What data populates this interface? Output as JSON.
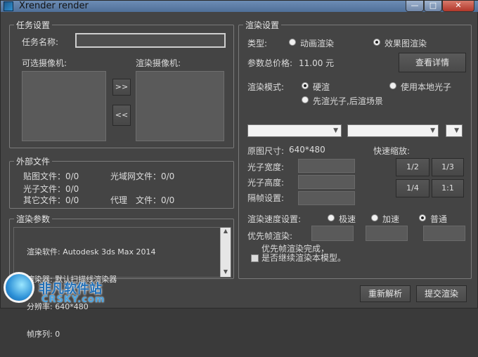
{
  "window": {
    "title": "Xrender render",
    "buttons": {
      "minimize": "—",
      "maximize": "□",
      "close": "✕"
    }
  },
  "task": {
    "group_label": "任务设置",
    "name_label": "任务名称:",
    "name_value": "",
    "available_cameras_label": "可选摄像机:",
    "render_cameras_label": "渲染摄像机:",
    "add_btn": ">>",
    "remove_btn": "<<"
  },
  "external_files": {
    "group_label": "外部文件",
    "map_files": "贴图文件：0/0",
    "ies_files": "光域网文件：0/0",
    "photon_files": "光子文件：0/0",
    "other_files": "其它文件：0/0",
    "proxy_files": "代理　文件：0/0"
  },
  "render_params": {
    "group_label": "渲染参数",
    "lines": [
      "渲染软件: Autodesk 3ds Max 2014",
      "渲染器: 默认扫描线渲染器",
      "分辨率: 640*480",
      "帧序列: 0"
    ]
  },
  "render_settings": {
    "group_label": "渲染设置",
    "type_label": "类型:",
    "type_animation": "动画渲染",
    "type_still": "效果图渲染",
    "type_selected": "still",
    "price_label": "参数总价格:",
    "price_value": "11.00 元",
    "details_btn": "查看详情",
    "mode_label": "渲染模式:",
    "mode_hard": "硬渲",
    "mode_local_photon": "使用本地光子",
    "mode_photon_then_scene": "先渲光子,后渲场景",
    "mode_selected": "hard",
    "combo1": "",
    "combo2": "",
    "combo3": "",
    "original_size_label": "原图尺寸:",
    "original_size_value": "640*480",
    "quick_zoom_label": "快速缩放:",
    "photon_width_label": "光子宽度:",
    "photon_height_label": "光子高度:",
    "frame_interval_label": "隔帧设置:",
    "zoom_buttons": [
      "1/2",
      "1/3",
      "1/4",
      "1:1"
    ],
    "speed_label": "渲染速度设置:",
    "speed_fast": "极速",
    "speed_accel": "加速",
    "speed_normal": "普通",
    "speed_selected": "normal",
    "priority_label": "优先帧渲染:",
    "priority_checkbox_text": "优先帧渲染完成，\n是否继续渲染本模型。"
  },
  "footer": {
    "reparse_btn": "重新解析",
    "submit_btn": "提交渲染"
  },
  "watermark": {
    "cn": "非凡软件站",
    "en": "CRSKY.com"
  }
}
